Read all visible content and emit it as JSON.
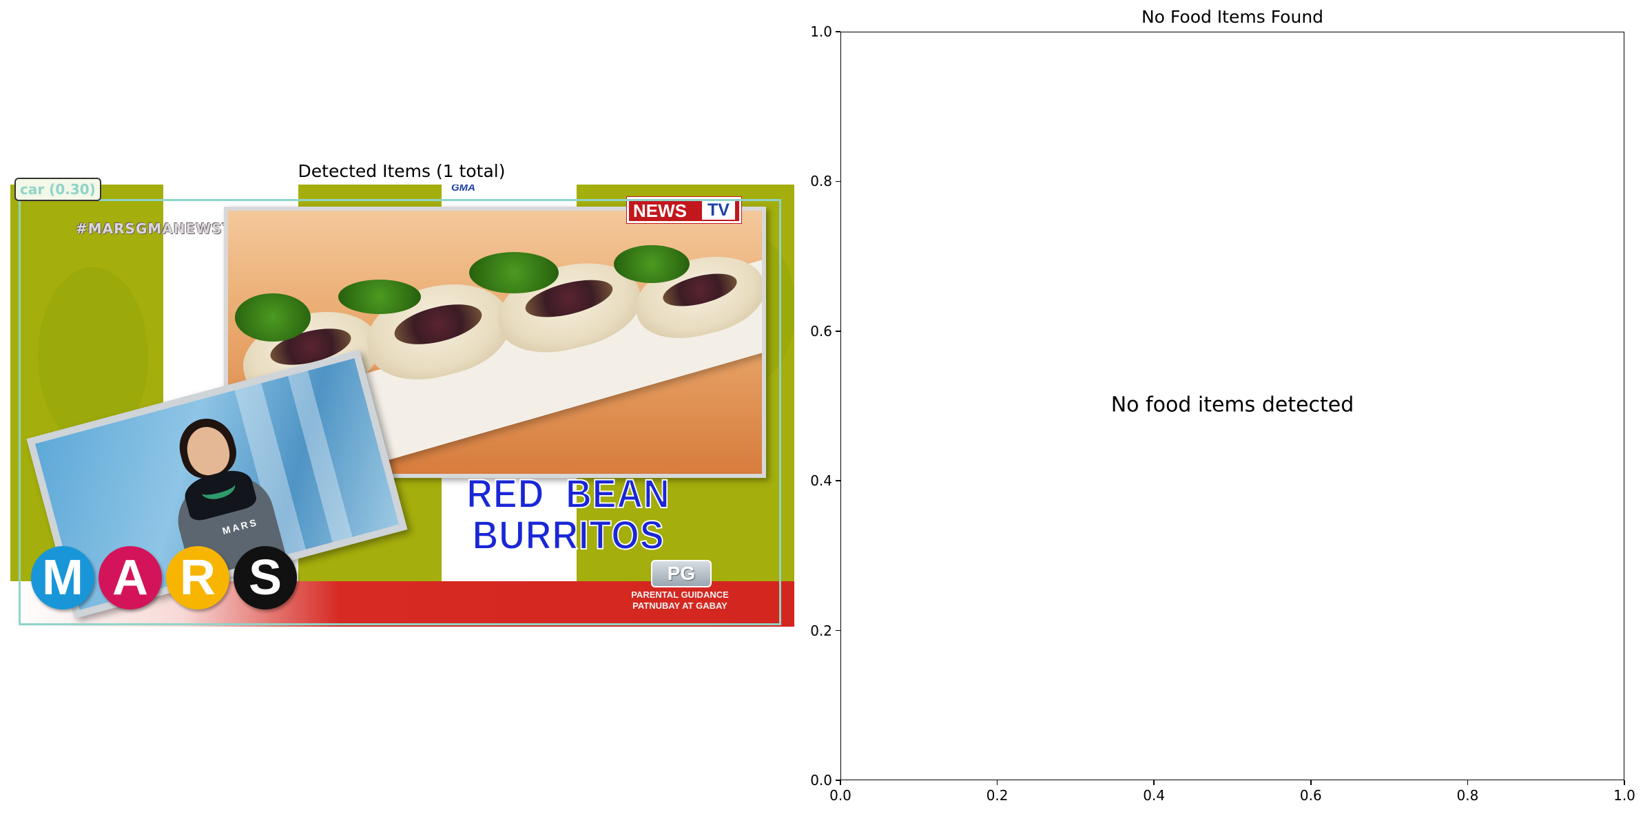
{
  "chart_data": [
    {
      "type": "image",
      "title": "Detected Items (1 total)",
      "detections": [
        {
          "label": "car (0.30)",
          "class": "car",
          "score": 0.3,
          "color": "#8fd4c8"
        }
      ],
      "image_content": {
        "hashtag": "#MARSGMANEWSTV",
        "network_logo": {
          "small": "GMA",
          "left": "NEWS",
          "right": "TV"
        },
        "dish_title_lines": [
          "RED  BEAN",
          "BURRITOS"
        ],
        "rating_badge": "PG",
        "rating_text_lines": [
          "PARENTAL GUIDANCE",
          "PATNUBAY AT GABAY"
        ],
        "show_logo_letters": [
          {
            "letter": "M",
            "color": "#1896d8"
          },
          {
            "letter": "A",
            "color": "#d4145a"
          },
          {
            "letter": "R",
            "color": "#f7b500"
          },
          {
            "letter": "S",
            "color": "#111111"
          }
        ],
        "apron_badge": "MARS"
      }
    },
    {
      "type": "scatter",
      "title": "No Food Items Found",
      "message": "No food items detected",
      "xlim": [
        0.0,
        1.0
      ],
      "ylim": [
        0.0,
        1.0
      ],
      "xticks": [
        "0.0",
        "0.2",
        "0.4",
        "0.6",
        "0.8",
        "1.0"
      ],
      "yticks": [
        "0.0",
        "0.2",
        "0.4",
        "0.6",
        "0.8",
        "1.0"
      ],
      "series": [],
      "grid": false
    }
  ]
}
